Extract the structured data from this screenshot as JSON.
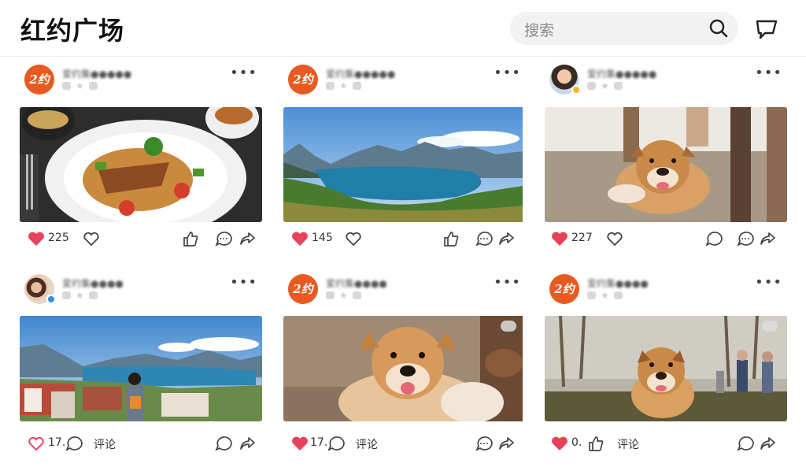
{
  "header": {
    "title": "红约广场",
    "search_placeholder": "搜索"
  },
  "posts": [
    {
      "avatar_text": "2约",
      "username": "爱约集●●●●●",
      "likes": "225",
      "image": "food-plate",
      "comment_label": ""
    },
    {
      "avatar_text": "2约",
      "username": "爱约集●●●●●",
      "likes": "145",
      "image": "lake-mountains",
      "comment_label": ""
    },
    {
      "avatar_text": "",
      "username": "爱约集●●●●●",
      "likes": "227",
      "image": "dog-indoor",
      "comment_label": ""
    },
    {
      "avatar_text": "",
      "username": "爱约集●●●●",
      "likes": "17.",
      "image": "coastal-town",
      "comment_label": "评论"
    },
    {
      "avatar_text": "2约",
      "username": "爱约集●●●●",
      "likes": "17.",
      "image": "dog-smiling",
      "comment_label": "评论"
    },
    {
      "avatar_text": "2约",
      "username": "爱约集●●●●",
      "likes": "0.",
      "image": "dog-park",
      "comment_label": "评论"
    }
  ],
  "colors": {
    "brand": "#e85a1f",
    "heart": "#e8415a",
    "search_bg": "#f2f2f2"
  },
  "icons": [
    "search-icon",
    "message-icon",
    "more-icon",
    "heart-icon",
    "heart-outline-icon",
    "thumbs-up-icon",
    "comment-icon",
    "share-icon"
  ]
}
